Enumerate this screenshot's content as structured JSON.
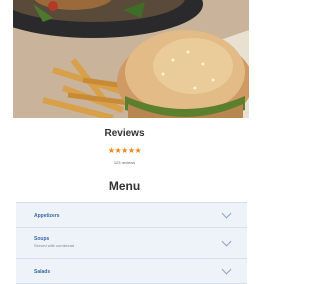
{
  "reviews": {
    "title": "Reviews",
    "stars": "★★★★★",
    "count_text": "123 reviews"
  },
  "menu": {
    "title": "Menu",
    "items": [
      {
        "label": "Appetizers",
        "subtitle": "",
        "icon": "chevron-down-icon"
      },
      {
        "label": "Soups",
        "subtitle": "Served with cornbread",
        "icon": "chevron-down-icon"
      },
      {
        "label": "Salads",
        "subtitle": "",
        "icon": "chevron-down-icon"
      }
    ]
  },
  "colors": {
    "star": "#e98a15",
    "menu_label": "#3a67a5",
    "accordion_bg": "#eef3fa"
  }
}
